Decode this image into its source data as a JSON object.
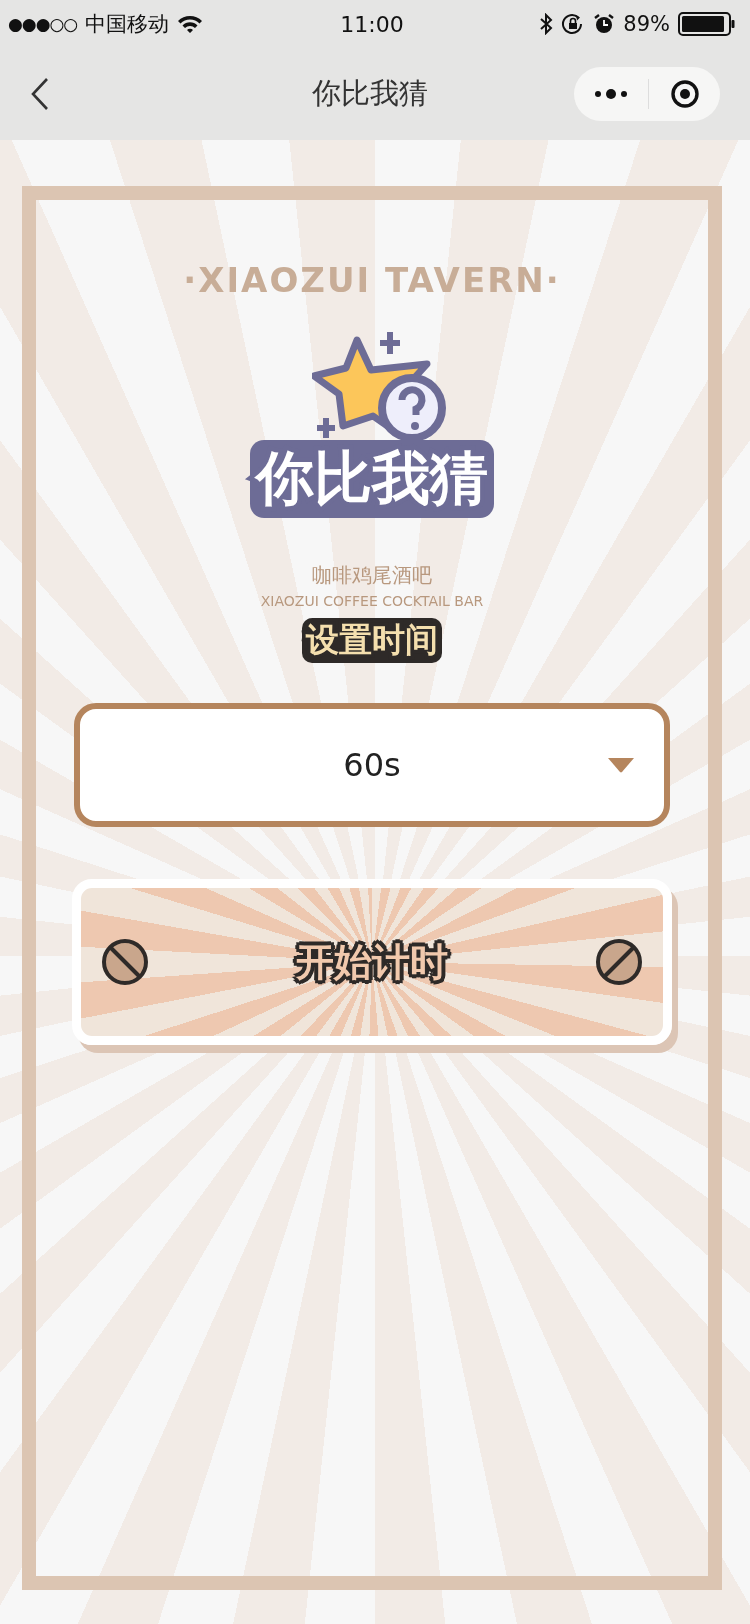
{
  "status_bar": {
    "signal": "●●●○○",
    "carrier": "中国移动",
    "time": "11:00",
    "battery": "89%"
  },
  "nav_bar": {
    "title": "你比我猜"
  },
  "background_logo": {
    "arc_text": "·XIAOZUI TAVERN·",
    "subtitle": "咖啡鸡尾酒吧",
    "tagline": "XIAOZUI COFFEE COCKTAIL BAR"
  },
  "game_title": "你比我猜",
  "time_label": "设置时间",
  "time_select": {
    "value": "60s"
  },
  "start_button": {
    "label": "开始计时"
  }
}
